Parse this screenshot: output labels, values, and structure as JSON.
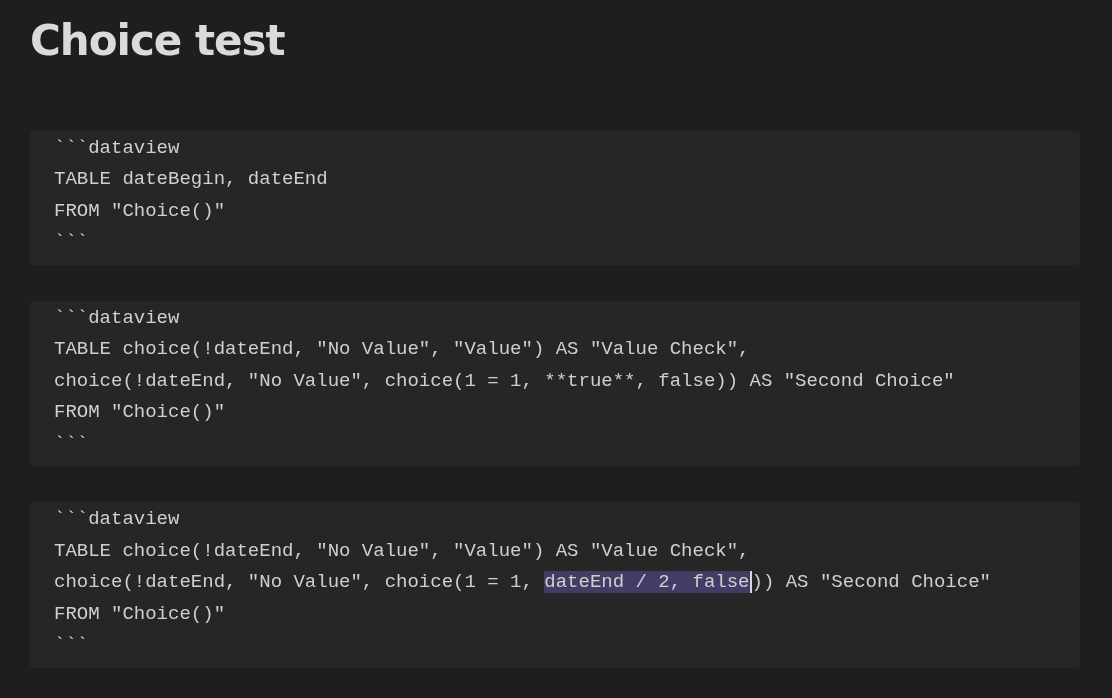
{
  "title": "Choice test",
  "code_blocks": [
    {
      "lines": [
        [
          {
            "text": "```dataview",
            "selected": false
          }
        ],
        [
          {
            "text": "TABLE dateBegin, dateEnd",
            "selected": false
          }
        ],
        [
          {
            "text": "FROM \"Choice()\"",
            "selected": false
          }
        ],
        [
          {
            "text": "```",
            "selected": false
          }
        ]
      ]
    },
    {
      "lines": [
        [
          {
            "text": "```dataview",
            "selected": false
          }
        ],
        [
          {
            "text": "TABLE choice(!dateEnd, \"No Value\", \"Value\") AS \"Value Check\",",
            "selected": false
          }
        ],
        [
          {
            "text": "choice(!dateEnd, \"No Value\", choice(1 = 1, **true**, false)) AS \"Second Choice\"",
            "selected": false
          }
        ],
        [
          {
            "text": "FROM \"Choice()\"",
            "selected": false
          }
        ],
        [
          {
            "text": "```",
            "selected": false
          }
        ]
      ]
    },
    {
      "lines": [
        [
          {
            "text": "```dataview",
            "selected": false
          }
        ],
        [
          {
            "text": "TABLE choice(!dateEnd, \"No Value\", \"Value\") AS \"Value Check\",",
            "selected": false
          }
        ],
        [
          {
            "text": "choice(!dateEnd, \"No Value\", choice(1 = 1, ",
            "selected": false
          },
          {
            "text": "dateEnd / 2, false",
            "selected": true
          },
          {
            "text": ")) AS \"Second Choice\"",
            "selected": false
          }
        ],
        [
          {
            "text": "FROM \"Choice()\"",
            "selected": false
          }
        ],
        [
          {
            "text": "```",
            "selected": false
          }
        ]
      ]
    }
  ]
}
